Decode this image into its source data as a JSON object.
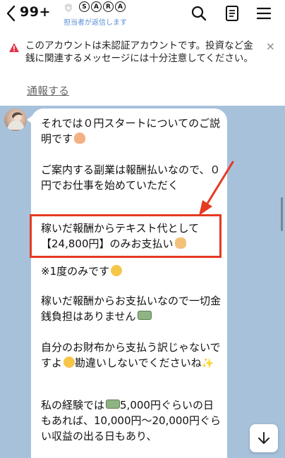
{
  "header": {
    "unread_count": "99+",
    "title_letters": [
      "S",
      "A",
      "R",
      "A"
    ],
    "subtitle": "担当者が返信します"
  },
  "warning": {
    "text": "このアカウントは未認証アカウントです。投資など金銭に関連するメッセージには十分注意してください。",
    "close": "×",
    "report_link": "通報する"
  },
  "messages": [
    {
      "text": "それでは０円スタートについてのご説明です",
      "emoji": "person"
    },
    {
      "text": "ご案内する副業は報酬払いなので、０円でお仕事を始めていただく"
    },
    {
      "text": "稼いだ報酬からテキスト代として【24,800円】のみお支払い",
      "emoji": "ok"
    },
    {
      "text": "※1度のみです",
      "emoji": "smile"
    },
    {
      "text": "稼いだ報酬からお支払いなので一切金銭負担はありません",
      "emoji": "cash"
    },
    {
      "text_a": "自分のお財布から支払う訳じゃないですよ",
      "text_b": "勘違いしないでくださいね",
      "spark": "✨"
    },
    {
      "text_a": "私の経験では",
      "text_b": "5,000円ぐらいの日もあれば、10,000円〜20,000円ぐらい収益の出る日もあり、"
    }
  ],
  "colors": {
    "chat_background": "#a7c1db",
    "highlight": "#e53a22",
    "link": "#5b8fd6",
    "warning_icon": "#e0344a"
  }
}
